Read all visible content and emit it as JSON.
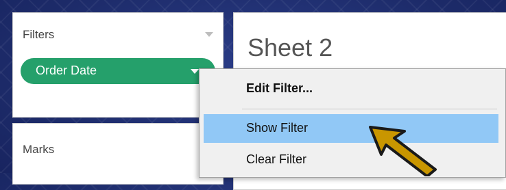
{
  "filters": {
    "title": "Filters",
    "pill_label": "Order Date"
  },
  "marks": {
    "title": "Marks"
  },
  "sheet": {
    "title": "Sheet 2"
  },
  "context_menu": {
    "items": [
      {
        "label": "Edit Filter..."
      },
      {
        "label": "Show Filter"
      },
      {
        "label": "Clear Filter"
      }
    ],
    "highlighted_item": "Show Filter"
  },
  "colors": {
    "pill": "#25a06b",
    "menu_highlight": "#91c8f6",
    "annotation_arrow": "#c99600",
    "background": "#1f2f72"
  },
  "icons": {
    "panel_menu": "chevron-down-icon",
    "pill_dropdown": "chevron-down-icon",
    "annotation": "arrow-pointer-icon"
  }
}
